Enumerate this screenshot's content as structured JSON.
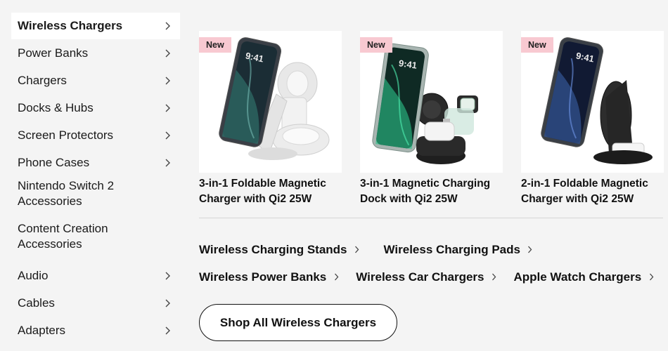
{
  "sidebar": {
    "items": [
      {
        "label": "Wireless Chargers",
        "active": true,
        "chevron": true
      },
      {
        "label": "Power Banks",
        "chevron": true
      },
      {
        "label": "Chargers",
        "chevron": true
      },
      {
        "label": "Docks & Hubs",
        "chevron": true
      },
      {
        "label": "Screen Protectors",
        "chevron": true
      },
      {
        "label": "Phone Cases",
        "chevron": true
      },
      {
        "label": "Nintendo Switch 2\nAccessories",
        "chevron": false
      },
      {
        "label": "Content Creation\nAccessories",
        "chevron": false
      },
      {
        "label": "Audio",
        "chevron": true
      },
      {
        "label": "Cables",
        "chevron": true
      },
      {
        "label": "Adapters",
        "chevron": true
      }
    ]
  },
  "products": [
    {
      "badge": "New",
      "title": "3-in-1 Foldable Magnetic Charger with Qi2 25W",
      "image_icon": "white-foldable-charger-image",
      "phone_time": "9:41"
    },
    {
      "badge": "New",
      "title": "3-in-1 Magnetic Charging Dock with Qi2 25W",
      "image_icon": "black-charging-dock-image",
      "phone_time": "9:41"
    },
    {
      "badge": "New",
      "title": "2-in-1 Foldable Magnetic Charger with Qi2 25W",
      "image_icon": "black-foldable-charger-image",
      "phone_time": "9:41"
    }
  ],
  "subcategories": {
    "row1": [
      "Wireless Charging Stands",
      "Wireless Charging Pads"
    ],
    "row2": [
      "Wireless Power Banks",
      "Wireless Car Chargers",
      "Apple Watch Chargers"
    ]
  },
  "shop_all_label": "Shop All Wireless Chargers",
  "colors": {
    "badge_bg": "#f8c9d1",
    "page_bg": "#f4f4f4",
    "card_bg": "#ffffff"
  }
}
